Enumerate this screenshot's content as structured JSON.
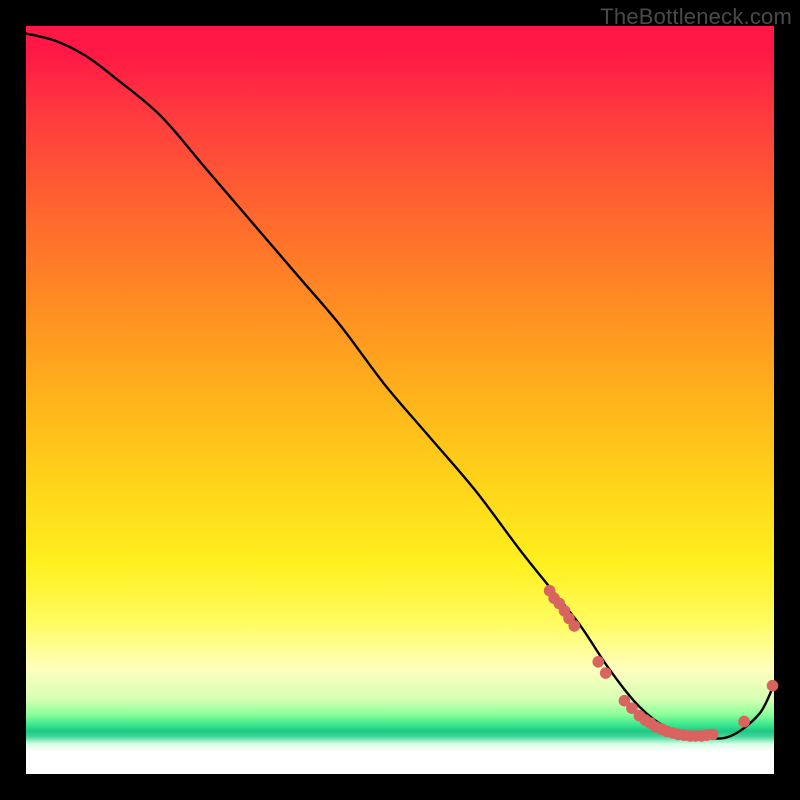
{
  "watermark": "TheBottleneck.com",
  "colors": {
    "background": "#000000",
    "gradient_top": "#ff1745",
    "gradient_mid": "#ffd61a",
    "gradient_low": "#35e58d",
    "gradient_bottom": "#ffffff",
    "curve": "#000000",
    "marker": "#d8635f"
  },
  "chart_data": {
    "type": "line",
    "title": "",
    "xlabel": "",
    "ylabel": "",
    "xlim": [
      0,
      100
    ],
    "ylim": [
      0,
      100
    ],
    "series": [
      {
        "name": "curve",
        "x": [
          0,
          4,
          8,
          12,
          18,
          24,
          30,
          36,
          42,
          48,
          54,
          60,
          66,
          70,
          74,
          78,
          82,
          86,
          90,
          94,
          98,
          100
        ],
        "y": [
          99,
          98,
          96,
          93,
          88,
          81,
          74,
          67,
          60,
          52,
          45,
          38,
          30,
          25,
          20,
          14,
          9,
          6,
          5,
          5,
          8,
          12
        ]
      }
    ],
    "markers": [
      {
        "x": 70.0,
        "y": 24.5
      },
      {
        "x": 70.6,
        "y": 23.5
      },
      {
        "x": 71.3,
        "y": 22.8
      },
      {
        "x": 72.0,
        "y": 21.8
      },
      {
        "x": 72.6,
        "y": 20.8
      },
      {
        "x": 73.3,
        "y": 19.8
      },
      {
        "x": 76.5,
        "y": 15.0
      },
      {
        "x": 77.5,
        "y": 13.5
      },
      {
        "x": 80.0,
        "y": 9.8
      },
      {
        "x": 81.0,
        "y": 8.8
      },
      {
        "x": 82.0,
        "y": 7.8
      },
      {
        "x": 82.8,
        "y": 7.2
      },
      {
        "x": 83.5,
        "y": 6.8
      },
      {
        "x": 84.2,
        "y": 6.3
      },
      {
        "x": 85.0,
        "y": 6.0
      },
      {
        "x": 85.7,
        "y": 5.7
      },
      {
        "x": 86.5,
        "y": 5.5
      },
      {
        "x": 87.2,
        "y": 5.3
      },
      {
        "x": 88.0,
        "y": 5.2
      },
      {
        "x": 88.8,
        "y": 5.1
      },
      {
        "x": 89.5,
        "y": 5.1
      },
      {
        "x": 90.3,
        "y": 5.1
      },
      {
        "x": 91.0,
        "y": 5.2
      },
      {
        "x": 91.8,
        "y": 5.3
      },
      {
        "x": 96.0,
        "y": 7.0
      },
      {
        "x": 99.8,
        "y": 11.8
      }
    ]
  }
}
